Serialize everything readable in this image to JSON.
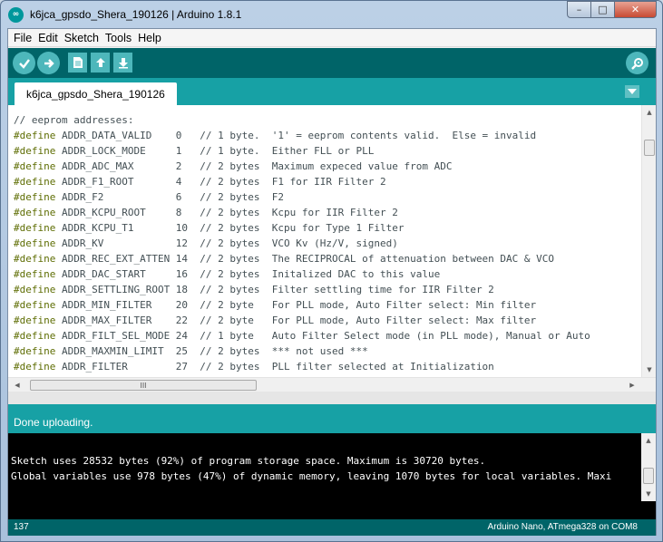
{
  "window": {
    "title": "k6jca_gpsdo_Shera_190126 | Arduino 1.8.1",
    "logo_glyph": "∞",
    "controls": {
      "minimize": "–",
      "maximize": "□",
      "close": "✕"
    }
  },
  "menu": [
    "File",
    "Edit",
    "Sketch",
    "Tools",
    "Help"
  ],
  "toolbar": {
    "buttons": [
      "verify",
      "upload",
      "new",
      "open",
      "save"
    ],
    "right": "serial-monitor"
  },
  "tab": {
    "label": "k6jca_gpsdo_Shera_190126"
  },
  "code_lines": [
    {
      "kw": "",
      "text": "// eeprom addresses:"
    },
    {
      "kw": "#define",
      "text": " ADDR_DATA_VALID    0   // 1 byte.  '1' = eeprom contents valid.  Else = invalid"
    },
    {
      "kw": "#define",
      "text": " ADDR_LOCK_MODE     1   // 1 byte.  Either FLL or PLL"
    },
    {
      "kw": "#define",
      "text": " ADDR_ADC_MAX       2   // 2 bytes  Maximum expeced value from ADC"
    },
    {
      "kw": "#define",
      "text": " ADDR_F1_ROOT       4   // 2 bytes  F1 for IIR Filter 2"
    },
    {
      "kw": "#define",
      "text": " ADDR_F2            6   // 2 bytes  F2"
    },
    {
      "kw": "#define",
      "text": " ADDR_KCPU_ROOT     8   // 2 bytes  Kcpu for IIR Filter 2"
    },
    {
      "kw": "#define",
      "text": " ADDR_KCPU_T1       10  // 2 bytes  Kcpu for Type 1 Filter"
    },
    {
      "kw": "#define",
      "text": " ADDR_KV            12  // 2 bytes  VCO Kv (Hz/V, signed)"
    },
    {
      "kw": "#define",
      "text": " ADDR_REC_EXT_ATTEN 14  // 2 bytes  The RECIPROCAL of attenuation between DAC & VCO"
    },
    {
      "kw": "#define",
      "text": " ADDR_DAC_START     16  // 2 bytes  Initalized DAC to this value"
    },
    {
      "kw": "#define",
      "text": " ADDR_SETTLING_ROOT 18  // 2 bytes  Filter settling time for IIR Filter 2"
    },
    {
      "kw": "#define",
      "text": " ADDR_MIN_FILTER    20  // 2 byte   For PLL mode, Auto Filter select: Min filter"
    },
    {
      "kw": "#define",
      "text": " ADDR_MAX_FILTER    22  // 2 byte   For PLL mode, Auto Filter select: Max filter"
    },
    {
      "kw": "#define",
      "text": " ADDR_FILT_SEL_MODE 24  // 1 byte   Auto Filter Select mode (in PLL mode), Manual or Auto"
    },
    {
      "kw": "#define",
      "text": " ADDR_MAXMIN_LIMIT  25  // 2 bytes  *** not used ***"
    },
    {
      "kw": "#define",
      "text": " ADDR_FILTER        27  // 2 bytes  PLL filter selected at Initialization"
    }
  ],
  "status": {
    "message": "Done uploading."
  },
  "console_lines": [
    "Sketch uses 28532 bytes (92%) of program storage space. Maximum is 30720 bytes.",
    "Global variables use 978 bytes (47%) of dynamic memory, leaving 1070 bytes for local variables. Maxi"
  ],
  "footer": {
    "line": "137",
    "board": "Arduino Nano, ATmega328 on COM8"
  },
  "colors": {
    "toolbar": "#006468",
    "teal": "#17a1a5",
    "button": "#4db7bb",
    "keyword": "#5e6d03"
  },
  "scroll_grip": "III"
}
